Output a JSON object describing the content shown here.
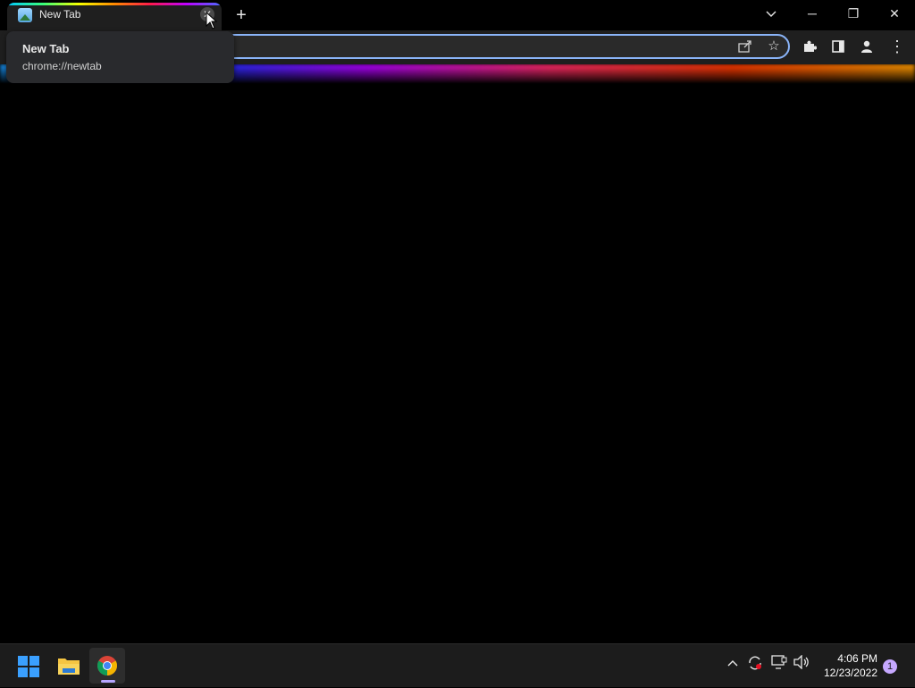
{
  "browser": {
    "tab": {
      "title": "New Tab",
      "close_glyph": "✕"
    },
    "new_tab_glyph": "+",
    "window_controls": {
      "tab_search_icon": "chevron-down-icon",
      "minimize_glyph": "─",
      "restore_glyph": "❐",
      "close_glyph": "✕"
    },
    "toolbar": {
      "share_icon": "share-icon",
      "bookmark_glyph": "☆",
      "extensions_icon": "puzzle-icon",
      "sidepanel_icon": "side-panel-icon",
      "profile_icon": "profile-icon",
      "menu_glyph": "⋮"
    },
    "hovercard": {
      "title": "New Tab",
      "url": "chrome://newtab"
    }
  },
  "taskbar": {
    "clock": {
      "time": "4:06 PM",
      "date": "12/23/2022"
    },
    "notifications": "1",
    "tray_chevron": "^"
  },
  "colors": {
    "accent": "#8ab4f8",
    "background": "#000000",
    "toolbar": "#1f1f1f",
    "taskbar": "#1c1c1c"
  }
}
